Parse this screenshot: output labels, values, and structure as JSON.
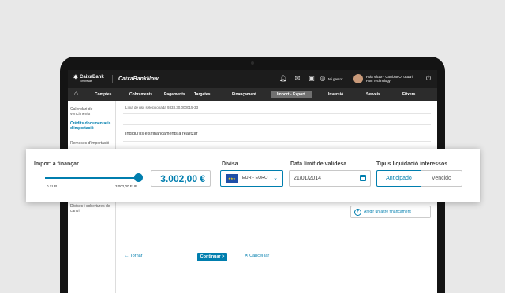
{
  "header": {
    "logo_name": "CaixaBank",
    "logo_sub": "Empresas",
    "app_name": "CaixaBankNow",
    "gestor_label": "Mi gestor",
    "user_line1": "Hola Víctor · Cambiar O \"usuari",
    "user_line2": "Fam Technology"
  },
  "nav": {
    "items": [
      "Comptes",
      "Cobraments",
      "Pagaments",
      "Targetes",
      "Finançament",
      "Import - Export",
      "Inversió",
      "Serveis",
      "Fitxers"
    ],
    "active": "Import - Export"
  },
  "sidebar": {
    "items": [
      "Calendari de venciments",
      "Crèdits documentaris d'importació",
      "Remeses d'importació",
      "Divises i cobertures de canvi"
    ]
  },
  "main": {
    "breadcrumb": "Línia de risc seleccionada 9333.30.000015-33",
    "section_title": "Indiqui'ns els finançaments a realitzar",
    "add_financing": "Afegir un altre finançament",
    "back_link": "← Tornar",
    "continue_button": "Continuar >",
    "cancel_link": "✕ Cancel·lar"
  },
  "form": {
    "import_label": "Import a finançar",
    "slider_min": "0 EUR",
    "slider_max": "3.002,00 EUR",
    "slider_level": 1.0,
    "amount_value": "3.002,00  €",
    "currency_label": "Divisa",
    "currency_value": "EUR - EURO",
    "date_label": "Data límit de validesa",
    "date_value": "21/01/2014",
    "settlement_label": "Tipus liquidació interessos",
    "settlement_options": [
      "Anticipado",
      "Vencido"
    ],
    "settlement_selected": "Anticipado"
  },
  "colors": {
    "accent": "#007eae",
    "topbar": "#1c1c1c",
    "navbar": "#2c2c2c"
  },
  "icons": [
    "home-icon",
    "bell-icon",
    "mail-icon",
    "briefcase-icon",
    "user-icon",
    "power-icon",
    "eu-flag-icon",
    "chevron-down-icon",
    "calendar-icon",
    "plus-circle-icon"
  ]
}
